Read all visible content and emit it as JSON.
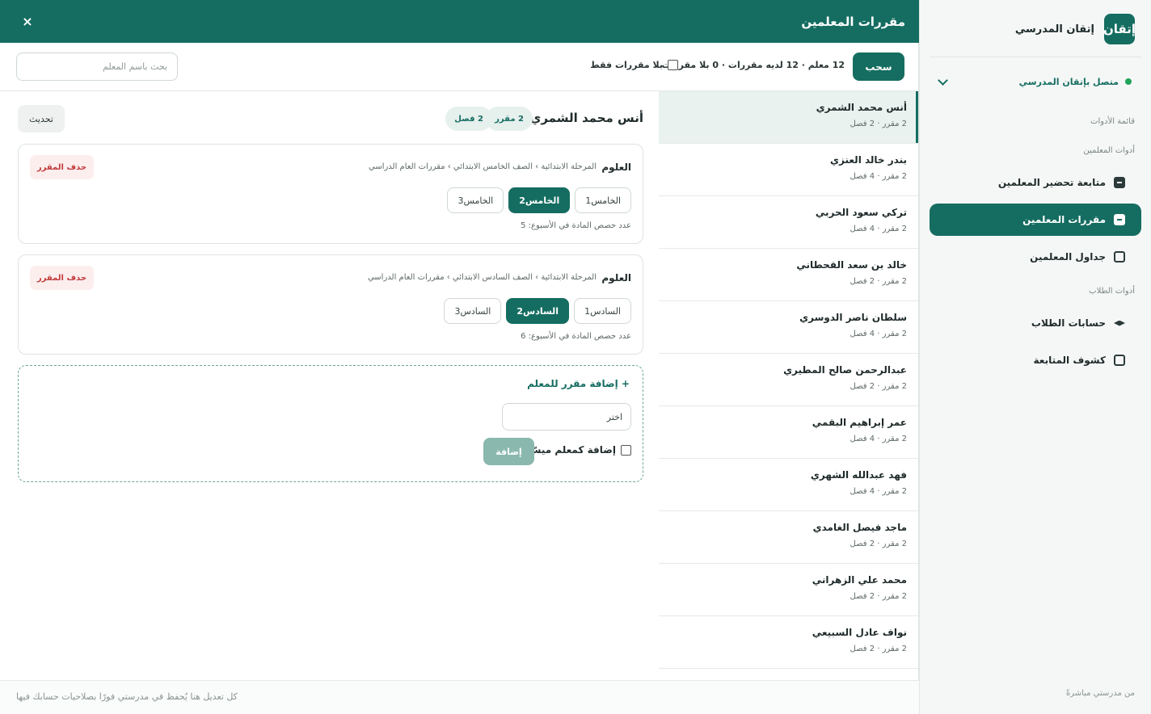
{
  "brand": {
    "logo_text": "إتقان",
    "name": "إتقان المدرسي"
  },
  "connection": {
    "status": "متصل بإتقان المدرسي"
  },
  "sidebar": {
    "labels": {
      "tools_list": "قائمة الأدوات",
      "teacher_tools": "أدوات المعلمين",
      "student_tools": "أدوات الطلاب"
    },
    "items": [
      {
        "label": "متابعة تحضير المعلمين",
        "icon": "clipboard-check-icon"
      },
      {
        "label": "مقررات المعلمين",
        "icon": "book-icon"
      },
      {
        "label": "جداول المعلمين",
        "icon": "calendar-icon"
      },
      {
        "label": "حسابات الطلاب",
        "icon": "graduation-cap-icon"
      },
      {
        "label": "كشوف المتابعة",
        "icon": "table-icon"
      }
    ],
    "footer": "من مدرستي مباشرةً"
  },
  "panel": {
    "title": "مقررات المعلمين",
    "close": "×",
    "toolbar": {
      "pull_button": "سحب",
      "stats": "12 معلم · 12 لديه مقررات · 0 بلا مقررات",
      "filter_label": "بلا مقررات فقط",
      "search_placeholder": "بحث باسم المعلم"
    },
    "footer_note": "كل تعديل هنا يُحفظ في مدرستي فورًا بصلاحيات حسابك فيها"
  },
  "teachers": [
    {
      "name": "أنس محمد الشمري",
      "meta": "2 مقرر · 2 فصل"
    },
    {
      "name": "بندر خالد العنزي",
      "meta": "2 مقرر · 4 فصل"
    },
    {
      "name": "تركي سعود الحربي",
      "meta": "2 مقرر · 4 فصل"
    },
    {
      "name": "خالد بن سعد القحطاني",
      "meta": "2 مقرر · 2 فصل"
    },
    {
      "name": "سلطان ناصر الدوسري",
      "meta": "2 مقرر · 4 فصل"
    },
    {
      "name": "عبدالرحمن صالح المطيري",
      "meta": "2 مقرر · 2 فصل"
    },
    {
      "name": "عمر إبراهيم البقمي",
      "meta": "2 مقرر · 4 فصل"
    },
    {
      "name": "فهد عبدالله الشهري",
      "meta": "2 مقرر · 4 فصل"
    },
    {
      "name": "ماجد فيصل الغامدي",
      "meta": "2 مقرر · 2 فصل"
    },
    {
      "name": "محمد علي الزهراني",
      "meta": "2 مقرر · 2 فصل"
    },
    {
      "name": "نواف عادل السبيعي",
      "meta": "2 مقرر · 2 فصل"
    }
  ],
  "detail": {
    "teacher_name": "أنس محمد الشمري",
    "courses_pill": "2 مقرر",
    "classes_pill": "2 فصل",
    "refresh_button": "تحديث",
    "courses": [
      {
        "subject": "العلوم",
        "path": "المرحلة الابتدائية › الصف الخامس الابتدائي › مقررات العام الدراسي",
        "delete_label": "حذف المقرر",
        "classes": [
          "الخامس1",
          "الخامس2",
          "الخامس3"
        ],
        "selected": "الخامس2",
        "weekly": "عدد حصص المادة في الأسبوع: 5"
      },
      {
        "subject": "العلوم",
        "path": "المرحلة الابتدائية › الصف السادس الابتدائي › مقررات العام الدراسي",
        "delete_label": "حذف المقرر",
        "classes": [
          "السادس1",
          "السادس2",
          "السادس3"
        ],
        "selected": "السادس2",
        "weekly": "عدد حصص المادة في الأسبوع: 6"
      }
    ],
    "add": {
      "title": "+ إضافة مقرر للمعلم",
      "select_placeholder": "اختر",
      "easy_teacher_label": "إضافة كمعلم ميسّر",
      "add_button": "إضافة"
    }
  },
  "colors": {
    "primary": "#156d61",
    "danger": "#c23b3b",
    "danger_bg": "#fdeeee",
    "online": "#22a35a"
  }
}
